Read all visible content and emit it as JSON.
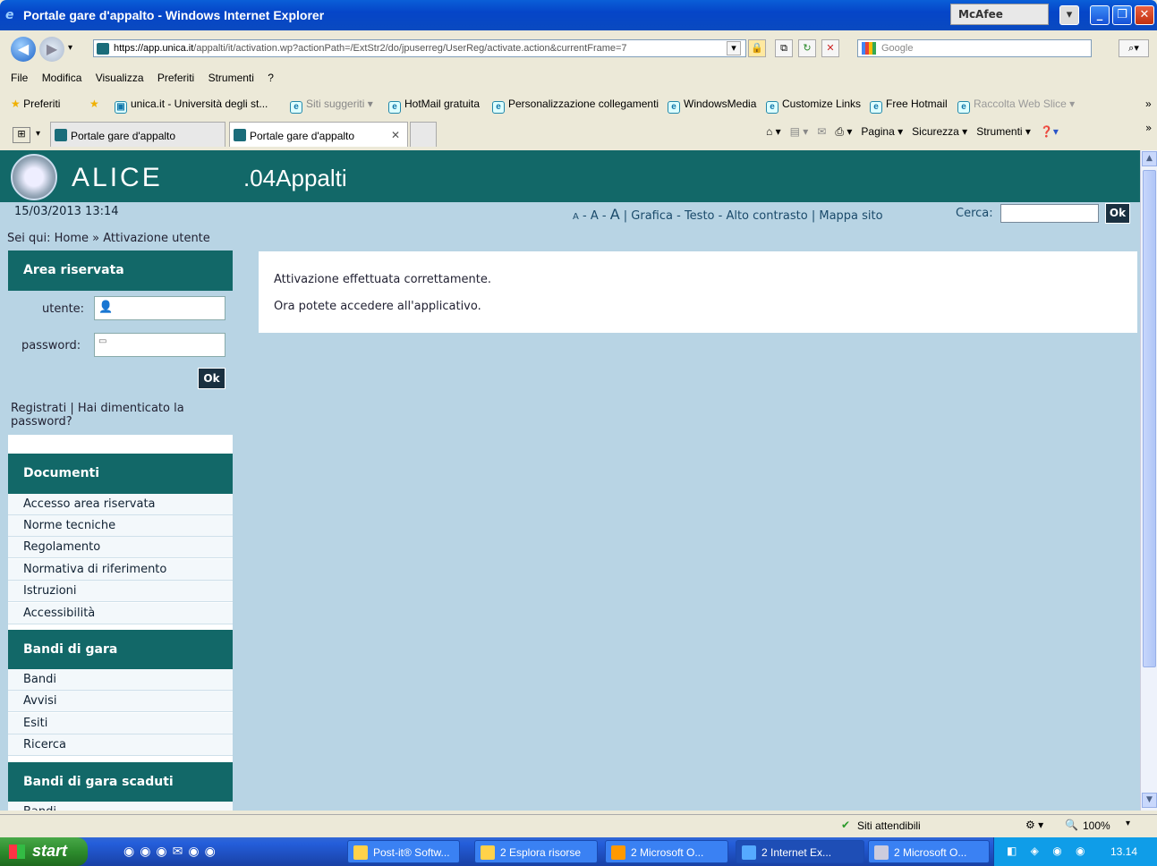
{
  "window": {
    "title": "Portale gare d'appalto - Windows Internet Explorer",
    "mcafee": "McAfee"
  },
  "address": {
    "scheme": "https://",
    "host": "app.unica.it",
    "path": "/appalti/it/activation.wp?actionPath=/ExtStr2/do/jpuserreg/UserReg/activate.action&currentFrame=7",
    "search_placeholder": "Google"
  },
  "menu": [
    "File",
    "Modifica",
    "Visualizza",
    "Preferiti",
    "Strumenti",
    "?"
  ],
  "favorites": {
    "label": "Preferiti",
    "items": [
      "unica.it - Università degli st...",
      "Siti suggeriti ▾",
      "HotMail gratuita",
      "Personalizzazione collegamenti",
      "WindowsMedia",
      "Customize Links",
      "Free Hotmail",
      "Raccolta Web Slice ▾"
    ]
  },
  "tabs": [
    "Portale gare d'appalto",
    "Portale gare d'appalto"
  ],
  "commands": {
    "pagina": "Pagina ▾",
    "sicurezza": "Sicurezza ▾",
    "strumenti": "Strumenti ▾"
  },
  "site": {
    "brand": "ALICE",
    "brand_suffix": ".04Appalti",
    "datetime": "15/03/2013 13:14",
    "access_small": "A",
    "access_medium": "A",
    "access_large": "A",
    "access_links": "Grafica - Testo - Alto contrasto | Mappa sito",
    "cerca_label": "Cerca:",
    "ok": "Ok",
    "breadcrumb": "Sei qui: Home » Attivazione utente"
  },
  "sidebar": {
    "area_title": "Area riservata",
    "user_label": "utente:",
    "password_label": "password:",
    "ok": "Ok",
    "register_text": "Registrati | Hai dimenticato la password?",
    "documenti_title": "Documenti",
    "documenti": [
      "Accesso area riservata",
      "Norme tecniche",
      "Regolamento",
      "Normativa di riferimento",
      "Istruzioni",
      "Accessibilità"
    ],
    "bandi_title": "Bandi di gara",
    "bandi": [
      "Bandi",
      "Avvisi",
      "Esiti",
      "Ricerca"
    ],
    "scaduti_title": "Bandi di gara scaduti",
    "scaduti_partial": "Bandi"
  },
  "content": {
    "line1": "Attivazione effettuata correttamente.",
    "line2": "Ora potete accedere all'applicativo."
  },
  "status": {
    "zone": "Siti attendibili",
    "zoom": "100%"
  },
  "taskbar": {
    "start": "start",
    "items": [
      "Post-it® Softw...",
      "2 Esplora risorse",
      "2 Microsoft O...",
      "2 Internet Ex...",
      "2 Microsoft O..."
    ],
    "clock": "13.14"
  }
}
